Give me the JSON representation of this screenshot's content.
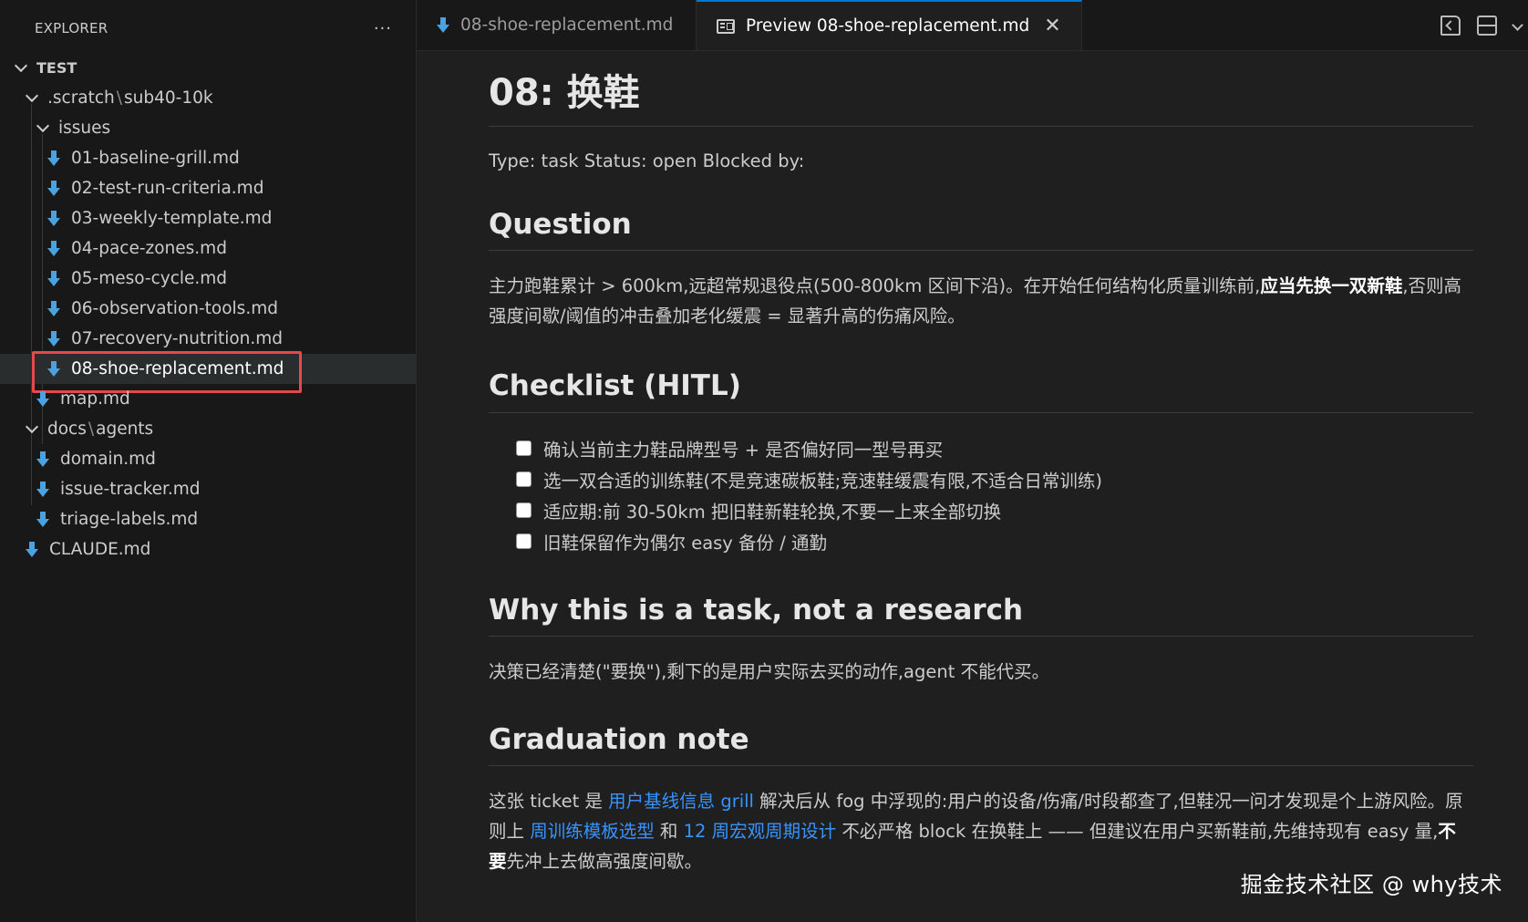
{
  "sidebar": {
    "title": "EXPLORER",
    "more": "···",
    "root": "TEST",
    "scratch_folder": [
      ".scratch",
      "sub40-10k"
    ],
    "issues_folder": "issues",
    "issues": [
      "01-baseline-grill.md",
      "02-test-run-criteria.md",
      "03-weekly-template.md",
      "04-pace-zones.md",
      "05-meso-cycle.md",
      "06-observation-tools.md",
      "07-recovery-nutrition.md",
      "08-shoe-replacement.md"
    ],
    "map_file": "map.md",
    "docs_folder": [
      "docs",
      "agents"
    ],
    "docs_files": [
      "domain.md",
      "issue-tracker.md",
      "triage-labels.md"
    ],
    "claude_file": "CLAUDE.md"
  },
  "tabs": {
    "source": "08-shoe-replacement.md",
    "preview": "Preview 08-shoe-replacement.md",
    "close": "✕"
  },
  "doc": {
    "title": "08: 换鞋",
    "meta": "Type: task Status: open Blocked by:",
    "question_heading": "Question",
    "question_p1": "主力跑鞋累计 > 600km,远超常规退役点(500-800km 区间下沿)。在开始任何结构化质量训练前,",
    "question_bold": "应当先换一双新鞋",
    "question_p2": ",否则高强度间歇/阈值的冲击叠加老化缓震 = 显著升高的伤痛风险。",
    "checklist_heading": "Checklist (HITL)",
    "checklist": [
      "确认当前主力鞋品牌型号 + 是否偏好同一型号再买",
      "选一双合适的训练鞋(不是竞速碳板鞋;竞速鞋缓震有限,不适合日常训练)",
      "适应期:前 30-50km 把旧鞋新鞋轮换,不要一上来全部切换",
      "旧鞋保留作为偶尔 easy 备份 / 通勤"
    ],
    "why_heading": "Why this is a task, not a research",
    "why_text": "决策已经清楚(\"要换\"),剩下的是用户实际去买的动作,agent 不能代买。",
    "grad_heading": "Graduation note",
    "grad_t1": "这张 ticket 是 ",
    "grad_link1": "用户基线信息 grill",
    "grad_t2": " 解决后从 fog 中浮现的:用户的设备/伤痛/时段都查了,但鞋况一问才发现是个上游风险。原则上 ",
    "grad_link2": "周训练模板选型",
    "grad_t3": " 和 ",
    "grad_link3": "12 周宏观周期设计",
    "grad_t4": " 不必严格 block 在换鞋上 —— 但建议在用户买新鞋前,先维持现有 easy 量,",
    "grad_bold": "不要",
    "grad_t5": "先冲上去做高强度间歇。"
  },
  "watermark": "掘金技术社区 @ why技术",
  "colors": {
    "accent": "#0078d4",
    "link": "#3794ff",
    "md_icon": "#4aa3e0",
    "highlight_box": "#e5484d"
  }
}
